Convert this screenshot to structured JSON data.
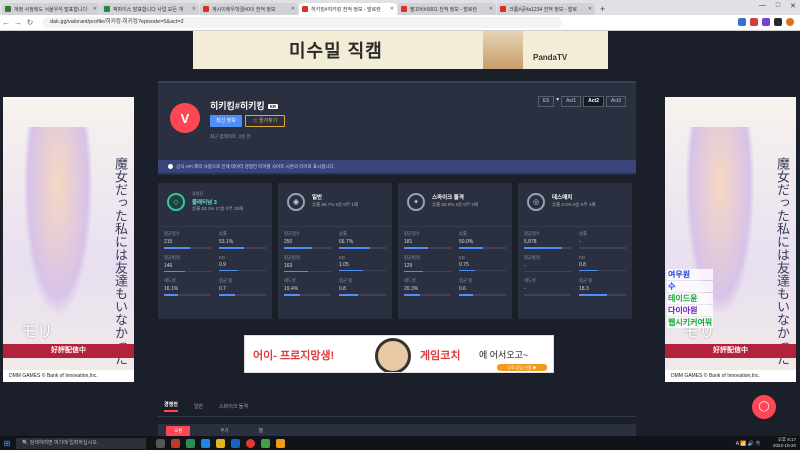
{
  "browser": {
    "tabs": [
      {
        "label": "계정 사정에도 서울우석 발표합니다",
        "color": "#2e7d32",
        "active": false
      },
      {
        "label": "픽파이스 발표합니다 사업 모든 개",
        "color": "#1e8e3e",
        "active": false
      },
      {
        "label": "계시이에우학결#0이 전적 정보",
        "color": "#d93025",
        "active": false
      },
      {
        "label": "히키킹#히키킹 전적 정보 - 발로란",
        "color": "#d93025",
        "active": true
      },
      {
        "label": "팔꼬비#0001 전적 정보 - 발로란",
        "color": "#d93025",
        "active": false
      },
      {
        "label": "크롬#공#a1234 전적 정보 - 발로",
        "color": "#d93025",
        "active": false
      }
    ],
    "url": "dak.gg/valorant/profile/히키킹-히키킹?episode=5&act=2",
    "new_tab": "+",
    "window_controls": [
      "—",
      "□",
      "✕"
    ]
  },
  "top_ad": {
    "text": "미수밀 직캠",
    "brand": "PandaTV"
  },
  "side_ad": {
    "jp_text": "魔女だった私には友達もいなかった",
    "logo": "モリ",
    "banner": "好評配信中",
    "footer": "DMM GAMES © Bank of Innovation,Inc."
  },
  "right_overlay_lines": [
    {
      "text": "여우원",
      "color": "#1a3fd1"
    },
    {
      "text": "수",
      "color": "#1a3fd1"
    },
    {
      "text": "테이드윤",
      "color": "#12a83c"
    },
    {
      "text": "다이아원",
      "color": "#6a1ab0"
    },
    {
      "text": "웹시키커여워",
      "color": "#12a83c"
    }
  ],
  "profile": {
    "name": "히키킹#히키킹",
    "region": "KR",
    "update_button": "최신 정보",
    "favorite_button": "즐겨찾기",
    "last_updated": "최근 업데이트: 2분 전",
    "seasons": [
      "E5",
      "Act1",
      "Act2",
      "Act3"
    ],
    "season_selected": "Act2"
  },
  "notice": "공식 API 제약 사항으로 인해 데이터 경쟁전 티어를 사이트 시즌의 티어로 표시합니다.",
  "cards": [
    {
      "icon": "rank-icon",
      "small": "경쟁전",
      "title": "",
      "tier": "플래티넘 3",
      "sub": "승률 53.1% 17승 0무 15패",
      "stats": [
        {
          "label": "평균점수",
          "value": "215",
          "fill": 0.55
        },
        {
          "label": "승률",
          "value": "53.1%",
          "fill": 0.53
        },
        {
          "label": "평균킬뎃",
          "value": "146",
          "fill": 0.45
        },
        {
          "label": "KD",
          "value": "0.9",
          "fill": 0.4
        },
        {
          "label": "헤드샷",
          "value": "16.1%",
          "fill": 0.3
        },
        {
          "label": "평균 킬",
          "value": "0.7",
          "fill": 0.35
        }
      ]
    },
    {
      "icon": "unrated-icon",
      "title": "일반",
      "sub": "승률 66.7% 2승 0무 1패",
      "highlight": "66.7%",
      "stats": [
        {
          "label": "평균점수",
          "value": "250",
          "fill": 0.6
        },
        {
          "label": "승률",
          "value": "66.7%",
          "fill": 0.67
        },
        {
          "label": "평균킬뎃",
          "value": "163",
          "fill": 0.5
        },
        {
          "label": "KD",
          "value": "1.05",
          "fill": 0.5
        },
        {
          "label": "헤드샷",
          "value": "19.4%",
          "fill": 0.35
        },
        {
          "label": "평균 킬",
          "value": "0.8",
          "fill": 0.4
        }
      ]
    },
    {
      "icon": "spike-rush-icon",
      "title": "스파이크 돌격",
      "sub": "승률 50.0% 2승 0무 2패",
      "highlight": "50.0%",
      "stats": [
        {
          "label": "평균점수",
          "value": "181",
          "fill": 0.5
        },
        {
          "label": "승률",
          "value": "50.0%",
          "fill": 0.5
        },
        {
          "label": "평균킬뎃",
          "value": "129",
          "fill": 0.4
        },
        {
          "label": "KD",
          "value": "0.75",
          "fill": 0.35
        },
        {
          "label": "헤드샷",
          "value": "20.3%",
          "fill": 0.35
        },
        {
          "label": "평균 킬",
          "value": "0.6",
          "fill": 0.3
        }
      ]
    },
    {
      "icon": "deathmatch-icon",
      "title": "데스매치",
      "sub": "승률 0.0% 0승 0무 4패",
      "highlight": "0.0%",
      "stats": [
        {
          "label": "평균점수",
          "value": "5,878",
          "fill": 0.8
        },
        {
          "label": "승률",
          "value": "-",
          "fill": 0.0
        },
        {
          "label": "평균킬뎃",
          "value": "-",
          "fill": 0.0
        },
        {
          "label": "KD",
          "value": "0.8",
          "fill": 0.4
        },
        {
          "label": "헤드샷",
          "value": "-",
          "fill": 0.0
        },
        {
          "label": "평균 킬",
          "value": "18.3",
          "fill": 0.6
        }
      ]
    }
  ],
  "bottom_ad": {
    "left": "어이- 프로지망생!",
    "middle": "게임코치",
    "right": "에 어서오고~",
    "cta": "무료 상담 신청 ▶"
  },
  "mode_tabs": [
    "경쟁전",
    "일반",
    "스파이크 돌격"
  ],
  "mode_tab_selected": "경쟁전",
  "sub_tabs": [
    "요원",
    "무기",
    "맵"
  ],
  "sub_tab_selected": "요원",
  "taskbar": {
    "search_placeholder": "검색하려면 여기에 입력하십시오.",
    "time": "오후 9:17",
    "date": "2022-10-20",
    "tray": "A 📶 🔊 가"
  }
}
